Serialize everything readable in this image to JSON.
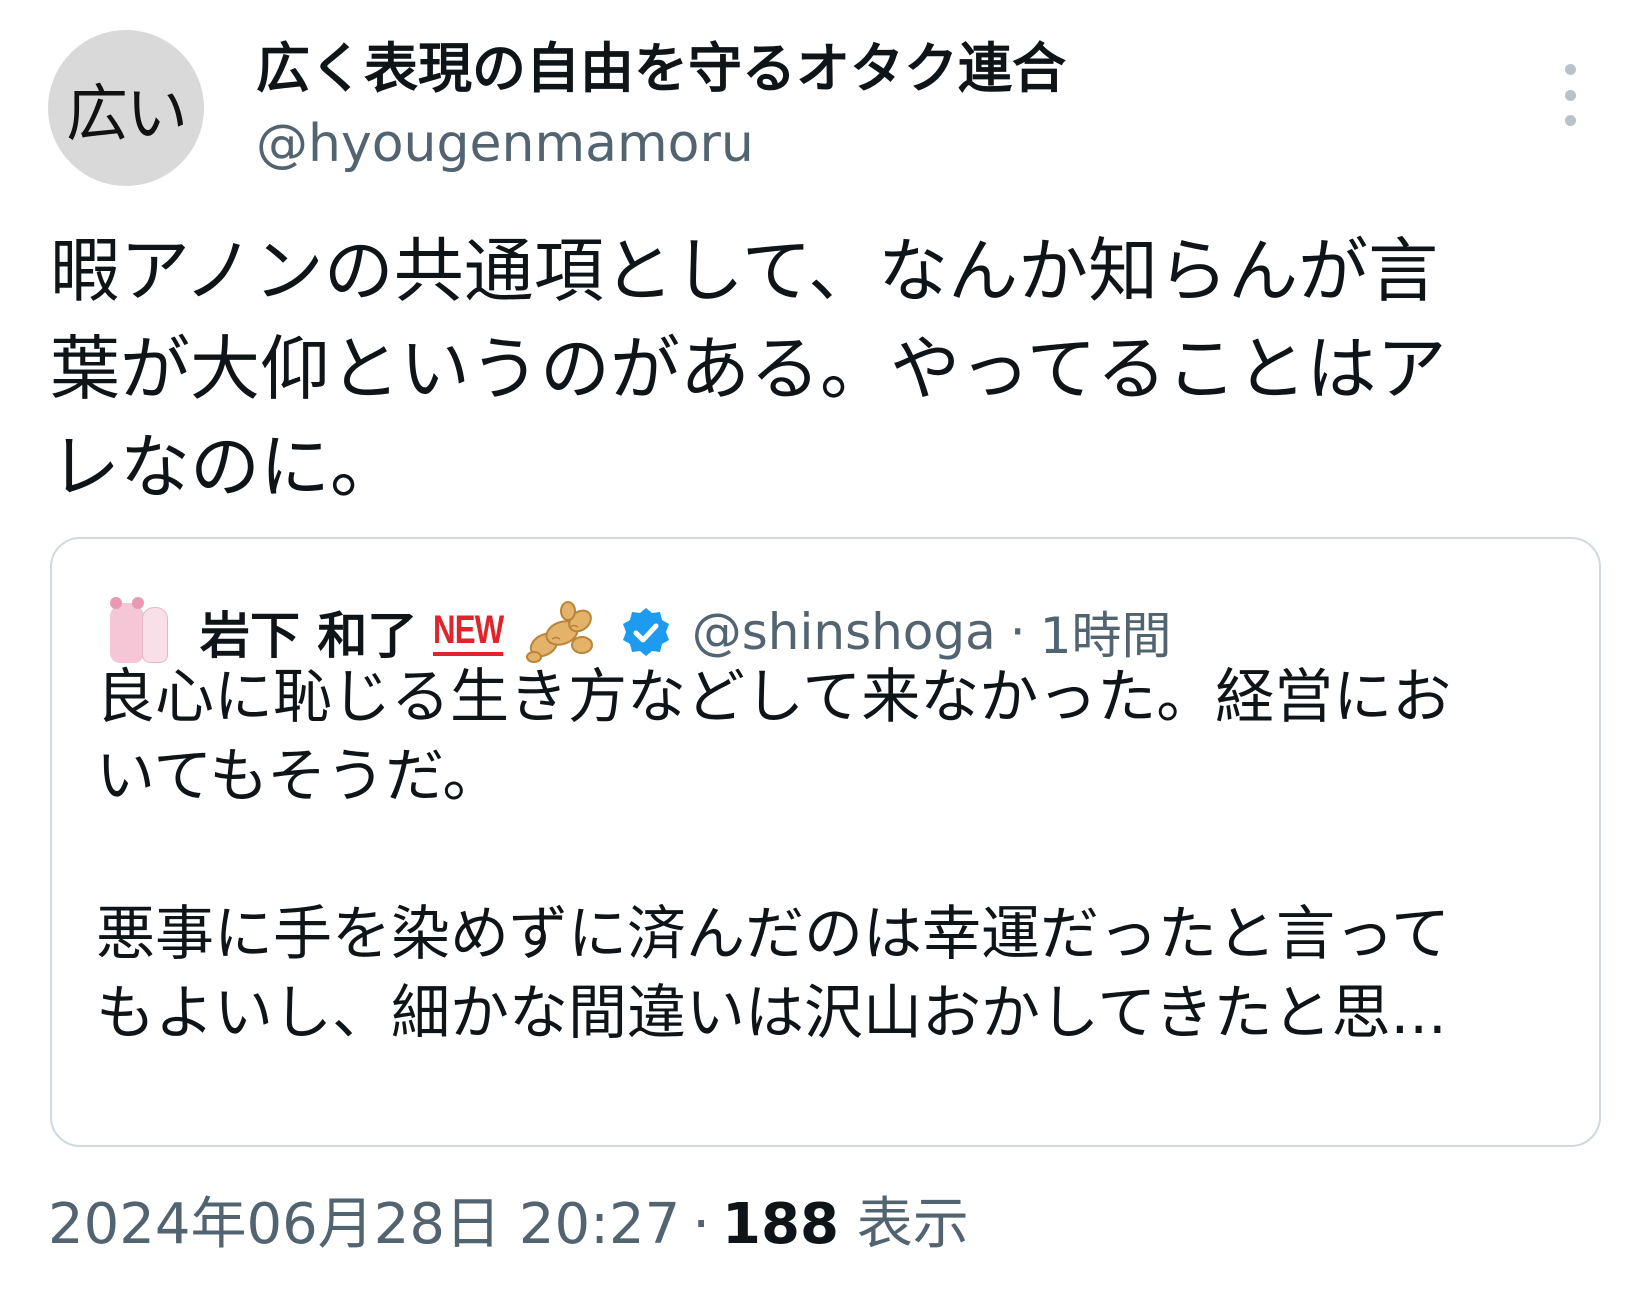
{
  "author": {
    "avatar_text": "広い",
    "display_name": "広く表現の自由を守るオタク連合",
    "handle": "@hyougenmamoru"
  },
  "menu": {
    "icon": "more-vertical-icon"
  },
  "tweet": {
    "text": "暇アノンの共通項として、なんか知らんが言\n葉が大仰というのがある。やってることはア\nレなのに。"
  },
  "quoted_tweet": {
    "display_name": "岩下 和了",
    "new_badge": "NEW",
    "emoji_icon": "ginger-icon",
    "verified_icon": "verified-badge-icon",
    "handle": "@shinshoga",
    "separator": "·",
    "time": "1時間",
    "text": "良心に恥じる生き方などして来なかった。経営にお\nいてもそうだ。\n\n悪事に手を染めずに済んだのは幸運だったと言って\nもよいし、細かな間違いは沢山おかしてきたと思..."
  },
  "meta": {
    "timestamp": "2024年06月28日 20:27",
    "separator": "·",
    "views_count": "188",
    "views_label": "表示"
  },
  "colors": {
    "text_primary": "#0f1419",
    "text_secondary": "#536471",
    "border": "#cfd9de",
    "verified_blue": "#1d9bf0",
    "new_red": "#e0242b"
  }
}
